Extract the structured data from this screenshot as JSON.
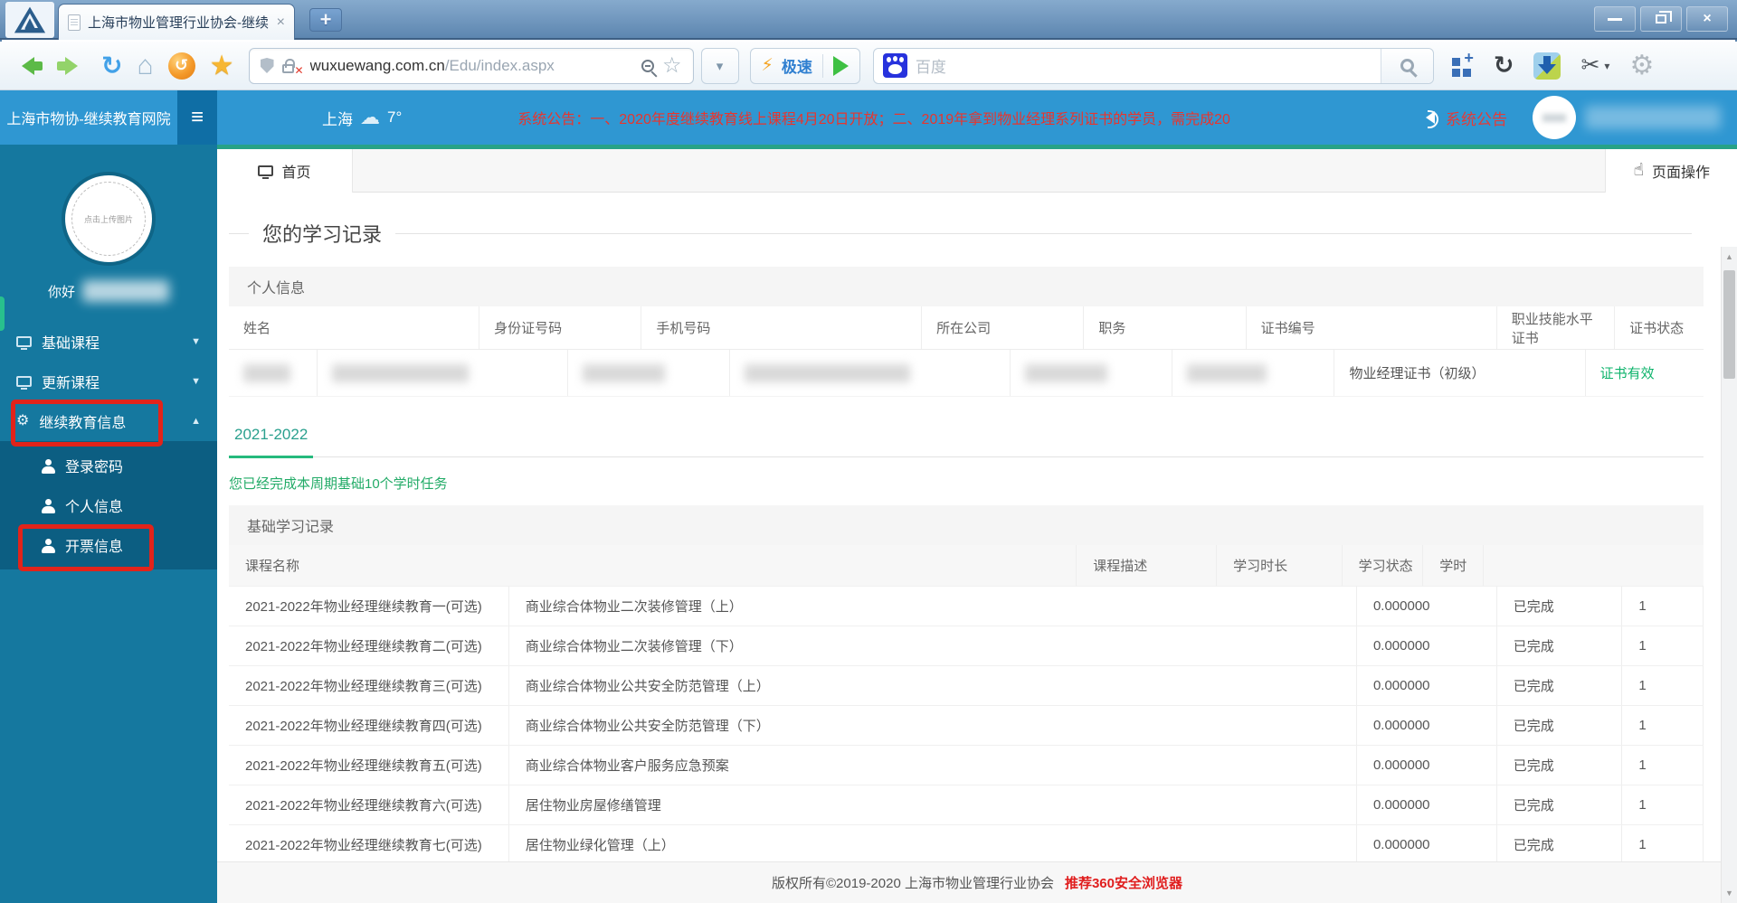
{
  "icons": {
    "tab_close": "×",
    "new_tab": "+",
    "window_close": "×",
    "hamburger": "≡",
    "refresh": "↻",
    "home": "⌂",
    "session_restore": "↺",
    "star": "★",
    "star_outline": "☆",
    "caret_down": "▾",
    "bolt": "⚡",
    "scissors": "✂",
    "gear": "⚙",
    "gear_small": "⚙",
    "cloud": "☁",
    "hand": "☝",
    "chev_down": "▼",
    "chev_up": "▲",
    "sb_up": "▲",
    "sb_down": "▼"
  },
  "browser": {
    "tab_title": "上海市物业管理行业协会-继续",
    "url_domain": "wuxuewang.com.cn",
    "url_path": "/Edu/index.aspx",
    "speed_label": "极速",
    "search_placeholder": "百度"
  },
  "header": {
    "brand": "上海市物协-继续教育网院",
    "city": "上海",
    "temperature": "7°",
    "announcement": "系统公告：一、2020年度继续教育线上课程4月20日开放；二、2019年拿到物业经理系列证书的学员，需完成20",
    "notice_label": "系统公告"
  },
  "sidebar": {
    "avatar_text": "点击上传图片",
    "greeting": "你好",
    "items": [
      {
        "label": "基础课程"
      },
      {
        "label": "更新课程"
      },
      {
        "label": "继续教育信息"
      }
    ],
    "subitems": [
      {
        "label": "登录密码"
      },
      {
        "label": "个人信息"
      },
      {
        "label": "开票信息"
      }
    ]
  },
  "main": {
    "home_tab": "首页",
    "page_ops": "页面操作",
    "page_title": "您的学习记录",
    "personal": {
      "section_title": "个人信息",
      "headers": [
        "姓名",
        "身份证号码",
        "手机号码",
        "所在公司",
        "职务",
        "证书编号",
        "职业技能水平证书",
        "证书状态"
      ],
      "cert_name": "物业经理证书（初级）",
      "cert_status": "证书有效"
    },
    "year_tab": "2021-2022",
    "done_message": "您已经完成本周期基础10个学时任务",
    "records_section": "基础学习记录",
    "course_table": {
      "headers": [
        "课程名称",
        "课程描述",
        "学习时长",
        "学习状态",
        "学时"
      ],
      "rows": [
        {
          "name": "2021-2022年物业经理继续教育一(可选)",
          "desc": "商业综合体物业二次装修管理（上）",
          "duration": "0.000000",
          "status": "已完成",
          "hours": "1"
        },
        {
          "name": "2021-2022年物业经理继续教育二(可选)",
          "desc": "商业综合体物业二次装修管理（下）",
          "duration": "0.000000",
          "status": "已完成",
          "hours": "1"
        },
        {
          "name": "2021-2022年物业经理继续教育三(可选)",
          "desc": "商业综合体物业公共安全防范管理（上）",
          "duration": "0.000000",
          "status": "已完成",
          "hours": "1"
        },
        {
          "name": "2021-2022年物业经理继续教育四(可选)",
          "desc": "商业综合体物业公共安全防范管理（下）",
          "duration": "0.000000",
          "status": "已完成",
          "hours": "1"
        },
        {
          "name": "2021-2022年物业经理继续教育五(可选)",
          "desc": "商业综合体物业客户服务应急预案",
          "duration": "0.000000",
          "status": "已完成",
          "hours": "1"
        },
        {
          "name": "2021-2022年物业经理继续教育六(可选)",
          "desc": "居住物业房屋修缮管理",
          "duration": "0.000000",
          "status": "已完成",
          "hours": "1"
        },
        {
          "name": "2021-2022年物业经理继续教育七(可选)",
          "desc": "居住物业绿化管理（上）",
          "duration": "0.000000",
          "status": "已完成",
          "hours": "1"
        }
      ]
    }
  },
  "footer": {
    "copyright": "版权所有©2019-2020 上海市物业管理行业协会",
    "recommend": "推荐360安全浏览器"
  }
}
